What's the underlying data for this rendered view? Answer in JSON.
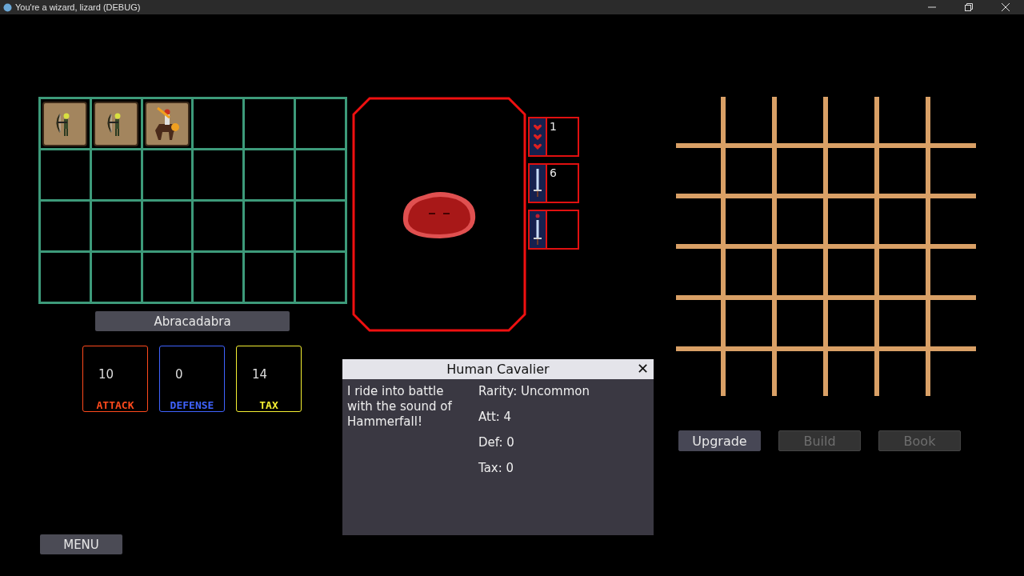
{
  "window": {
    "title": "You're a wizard, lizard (DEBUG)"
  },
  "inventory": {
    "slots": [
      {
        "kind": "archer"
      },
      {
        "kind": "archer"
      },
      {
        "kind": "cavalier"
      },
      {
        "kind": "empty"
      },
      {
        "kind": "empty"
      },
      {
        "kind": "empty"
      },
      {
        "kind": "empty"
      },
      {
        "kind": "empty"
      },
      {
        "kind": "empty"
      },
      {
        "kind": "empty"
      },
      {
        "kind": "empty"
      },
      {
        "kind": "empty"
      },
      {
        "kind": "empty"
      },
      {
        "kind": "empty"
      },
      {
        "kind": "empty"
      },
      {
        "kind": "empty"
      },
      {
        "kind": "empty"
      },
      {
        "kind": "empty"
      },
      {
        "kind": "empty"
      },
      {
        "kind": "empty"
      },
      {
        "kind": "empty"
      },
      {
        "kind": "empty"
      },
      {
        "kind": "empty"
      },
      {
        "kind": "empty"
      }
    ]
  },
  "name_button": "Abracadabra",
  "stats": [
    {
      "value": "10",
      "label": "ATTACK",
      "color": "#ff4a1c"
    },
    {
      "value": "0",
      "label": "DEFENSE",
      "color": "#3f63ff"
    },
    {
      "value": "14",
      "label": "TAX",
      "color": "#f5f032"
    }
  ],
  "card": {
    "side_slots": [
      {
        "kind": "hearts",
        "value": "1"
      },
      {
        "kind": "sword",
        "value": "6"
      },
      {
        "kind": "gem-sword"
      }
    ]
  },
  "dialog": {
    "title": "Human Cavalier",
    "close": "✕",
    "description": "I ride into battle with the sound of Hammerfall!",
    "details": [
      "Rarity: Uncommon",
      "Att: 4",
      "Def: 0",
      "Tax: 0"
    ]
  },
  "actions": [
    {
      "label": "Upgrade",
      "disabled": false
    },
    {
      "label": "Build",
      "disabled": true
    },
    {
      "label": "Book",
      "disabled": true
    }
  ],
  "menu_button": "MENU"
}
